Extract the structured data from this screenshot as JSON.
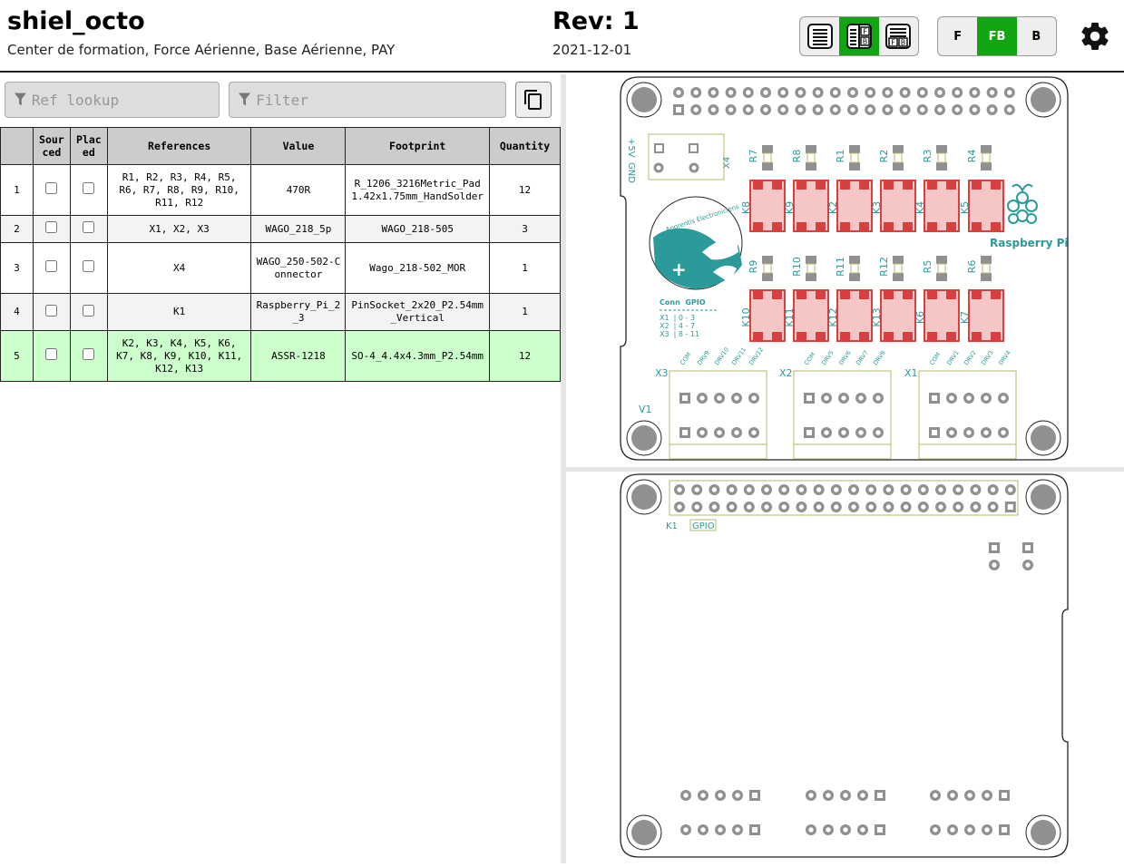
{
  "header": {
    "title": "shiel_octo",
    "company": "Center de formation, Force Aérienne, Base Aérienne, PAY",
    "revision": "Rev: 1",
    "date": "2021-12-01",
    "layout_buttons": [
      "bom-only",
      "bom-left",
      "bom-top"
    ],
    "layout_active": "bom-left",
    "side_buttons": {
      "front": "F",
      "both": "FB",
      "back": "B"
    },
    "side_active": "FB",
    "accent_color": "#11a611"
  },
  "controls": {
    "ref_lookup_placeholder": "Ref lookup",
    "filter_placeholder": "Filter"
  },
  "bom": {
    "headers": {
      "num": "",
      "sourced": "Sour\nced",
      "placed": "Plac\ned",
      "references": "References",
      "value": "Value",
      "footprint": "Footprint",
      "quantity": "Quantity"
    },
    "rows": [
      {
        "num": "1",
        "references": "R1, R2, R3, R4, R5, R6, R7, R8, R9, R10, R11, R12",
        "value": "470R",
        "footprint": "R_1206_3216Metric_Pad1.42x1.75mm_HandSolder",
        "quantity": "12",
        "sourced": false,
        "placed": false
      },
      {
        "num": "2",
        "references": "X1, X2, X3",
        "value": "WAGO_218_5p",
        "footprint": "WAGO_218-505",
        "quantity": "3",
        "sourced": false,
        "placed": false
      },
      {
        "num": "3",
        "references": "X4",
        "value": "WAGO_250-502-Connector",
        "footprint": "Wago_218-502_MOR",
        "quantity": "1",
        "sourced": false,
        "placed": false
      },
      {
        "num": "4",
        "references": "K1",
        "value": "Raspberry_Pi_2_3",
        "footprint": "PinSocket_2x20_P2.54mm_Vertical",
        "quantity": "1",
        "sourced": false,
        "placed": false
      },
      {
        "num": "5",
        "references": "K2, K3, K4, K5, K6, K7, K8, K9, K10, K11, K12, K13",
        "value": "ASSR-1218",
        "footprint": "SO-4_4.4x4.3mm_P2.54mm",
        "quantity": "12",
        "sourced": false,
        "placed": false
      }
    ],
    "highlight_color": "#ccffcc"
  },
  "pcb": {
    "front_silk": {
      "resistors_top": [
        "R7",
        "R8",
        "R1",
        "R2",
        "R3",
        "R4"
      ],
      "relays_top": [
        "K8",
        "K9",
        "K2",
        "K3",
        "K4",
        "K5"
      ],
      "resistors_bottom": [
        "R9",
        "R10",
        "R11",
        "R12",
        "R5",
        "R6"
      ],
      "relays_bottom": [
        "K10",
        "K11",
        "K12",
        "K13",
        "K6",
        "K7"
      ],
      "power_label": "+5V",
      "gnd_label": "GND",
      "connector_x4": "X4",
      "logo_text": "Raspberry Pi",
      "badge_text": "Apprentis Electroniciens",
      "table_head": "Conn  GPIO",
      "table_rows": [
        "X1  | 0 - 3",
        "X2  | 4 - 7",
        "X3  | 8 - 11"
      ],
      "v1": "V1",
      "terminals": [
        {
          "ref": "X3",
          "pins": [
            "COM",
            "DRV9",
            "DRV10",
            "DRV11",
            "DRV12"
          ]
        },
        {
          "ref": "X2",
          "pins": [
            "COM",
            "DRV5",
            "DRV6",
            "DRV7",
            "DRV8"
          ]
        },
        {
          "ref": "X1",
          "pins": [
            "COM",
            "DRV1",
            "DRV2",
            "DRV3",
            "DRV4"
          ]
        }
      ]
    },
    "back_silk": {
      "k1": "K1",
      "gpio": "GPIO"
    },
    "colors": {
      "board_edge": "#222222",
      "silk": "#2a9a9a",
      "pad_gray": "#909090",
      "relay_red": "#d84040",
      "relay_fill": "#f4c6c6",
      "fab_outline": "#b8b86a"
    }
  }
}
